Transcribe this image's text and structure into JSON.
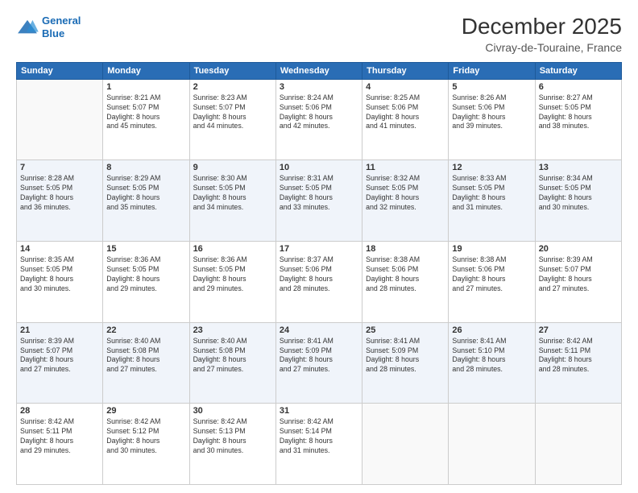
{
  "header": {
    "logo_line1": "General",
    "logo_line2": "Blue",
    "title": "December 2025",
    "subtitle": "Civray-de-Touraine, France"
  },
  "days_of_week": [
    "Sunday",
    "Monday",
    "Tuesday",
    "Wednesday",
    "Thursday",
    "Friday",
    "Saturday"
  ],
  "weeks": [
    [
      {
        "day": "",
        "info": ""
      },
      {
        "day": "1",
        "info": "Sunrise: 8:21 AM\nSunset: 5:07 PM\nDaylight: 8 hours\nand 45 minutes."
      },
      {
        "day": "2",
        "info": "Sunrise: 8:23 AM\nSunset: 5:07 PM\nDaylight: 8 hours\nand 44 minutes."
      },
      {
        "day": "3",
        "info": "Sunrise: 8:24 AM\nSunset: 5:06 PM\nDaylight: 8 hours\nand 42 minutes."
      },
      {
        "day": "4",
        "info": "Sunrise: 8:25 AM\nSunset: 5:06 PM\nDaylight: 8 hours\nand 41 minutes."
      },
      {
        "day": "5",
        "info": "Sunrise: 8:26 AM\nSunset: 5:06 PM\nDaylight: 8 hours\nand 39 minutes."
      },
      {
        "day": "6",
        "info": "Sunrise: 8:27 AM\nSunset: 5:05 PM\nDaylight: 8 hours\nand 38 minutes."
      }
    ],
    [
      {
        "day": "7",
        "info": "Sunrise: 8:28 AM\nSunset: 5:05 PM\nDaylight: 8 hours\nand 36 minutes."
      },
      {
        "day": "8",
        "info": "Sunrise: 8:29 AM\nSunset: 5:05 PM\nDaylight: 8 hours\nand 35 minutes."
      },
      {
        "day": "9",
        "info": "Sunrise: 8:30 AM\nSunset: 5:05 PM\nDaylight: 8 hours\nand 34 minutes."
      },
      {
        "day": "10",
        "info": "Sunrise: 8:31 AM\nSunset: 5:05 PM\nDaylight: 8 hours\nand 33 minutes."
      },
      {
        "day": "11",
        "info": "Sunrise: 8:32 AM\nSunset: 5:05 PM\nDaylight: 8 hours\nand 32 minutes."
      },
      {
        "day": "12",
        "info": "Sunrise: 8:33 AM\nSunset: 5:05 PM\nDaylight: 8 hours\nand 31 minutes."
      },
      {
        "day": "13",
        "info": "Sunrise: 8:34 AM\nSunset: 5:05 PM\nDaylight: 8 hours\nand 30 minutes."
      }
    ],
    [
      {
        "day": "14",
        "info": "Sunrise: 8:35 AM\nSunset: 5:05 PM\nDaylight: 8 hours\nand 30 minutes."
      },
      {
        "day": "15",
        "info": "Sunrise: 8:36 AM\nSunset: 5:05 PM\nDaylight: 8 hours\nand 29 minutes."
      },
      {
        "day": "16",
        "info": "Sunrise: 8:36 AM\nSunset: 5:05 PM\nDaylight: 8 hours\nand 29 minutes."
      },
      {
        "day": "17",
        "info": "Sunrise: 8:37 AM\nSunset: 5:06 PM\nDaylight: 8 hours\nand 28 minutes."
      },
      {
        "day": "18",
        "info": "Sunrise: 8:38 AM\nSunset: 5:06 PM\nDaylight: 8 hours\nand 28 minutes."
      },
      {
        "day": "19",
        "info": "Sunrise: 8:38 AM\nSunset: 5:06 PM\nDaylight: 8 hours\nand 27 minutes."
      },
      {
        "day": "20",
        "info": "Sunrise: 8:39 AM\nSunset: 5:07 PM\nDaylight: 8 hours\nand 27 minutes."
      }
    ],
    [
      {
        "day": "21",
        "info": "Sunrise: 8:39 AM\nSunset: 5:07 PM\nDaylight: 8 hours\nand 27 minutes."
      },
      {
        "day": "22",
        "info": "Sunrise: 8:40 AM\nSunset: 5:08 PM\nDaylight: 8 hours\nand 27 minutes."
      },
      {
        "day": "23",
        "info": "Sunrise: 8:40 AM\nSunset: 5:08 PM\nDaylight: 8 hours\nand 27 minutes."
      },
      {
        "day": "24",
        "info": "Sunrise: 8:41 AM\nSunset: 5:09 PM\nDaylight: 8 hours\nand 27 minutes."
      },
      {
        "day": "25",
        "info": "Sunrise: 8:41 AM\nSunset: 5:09 PM\nDaylight: 8 hours\nand 28 minutes."
      },
      {
        "day": "26",
        "info": "Sunrise: 8:41 AM\nSunset: 5:10 PM\nDaylight: 8 hours\nand 28 minutes."
      },
      {
        "day": "27",
        "info": "Sunrise: 8:42 AM\nSunset: 5:11 PM\nDaylight: 8 hours\nand 28 minutes."
      }
    ],
    [
      {
        "day": "28",
        "info": "Sunrise: 8:42 AM\nSunset: 5:11 PM\nDaylight: 8 hours\nand 29 minutes."
      },
      {
        "day": "29",
        "info": "Sunrise: 8:42 AM\nSunset: 5:12 PM\nDaylight: 8 hours\nand 30 minutes."
      },
      {
        "day": "30",
        "info": "Sunrise: 8:42 AM\nSunset: 5:13 PM\nDaylight: 8 hours\nand 30 minutes."
      },
      {
        "day": "31",
        "info": "Sunrise: 8:42 AM\nSunset: 5:14 PM\nDaylight: 8 hours\nand 31 minutes."
      },
      {
        "day": "",
        "info": ""
      },
      {
        "day": "",
        "info": ""
      },
      {
        "day": "",
        "info": ""
      }
    ]
  ]
}
